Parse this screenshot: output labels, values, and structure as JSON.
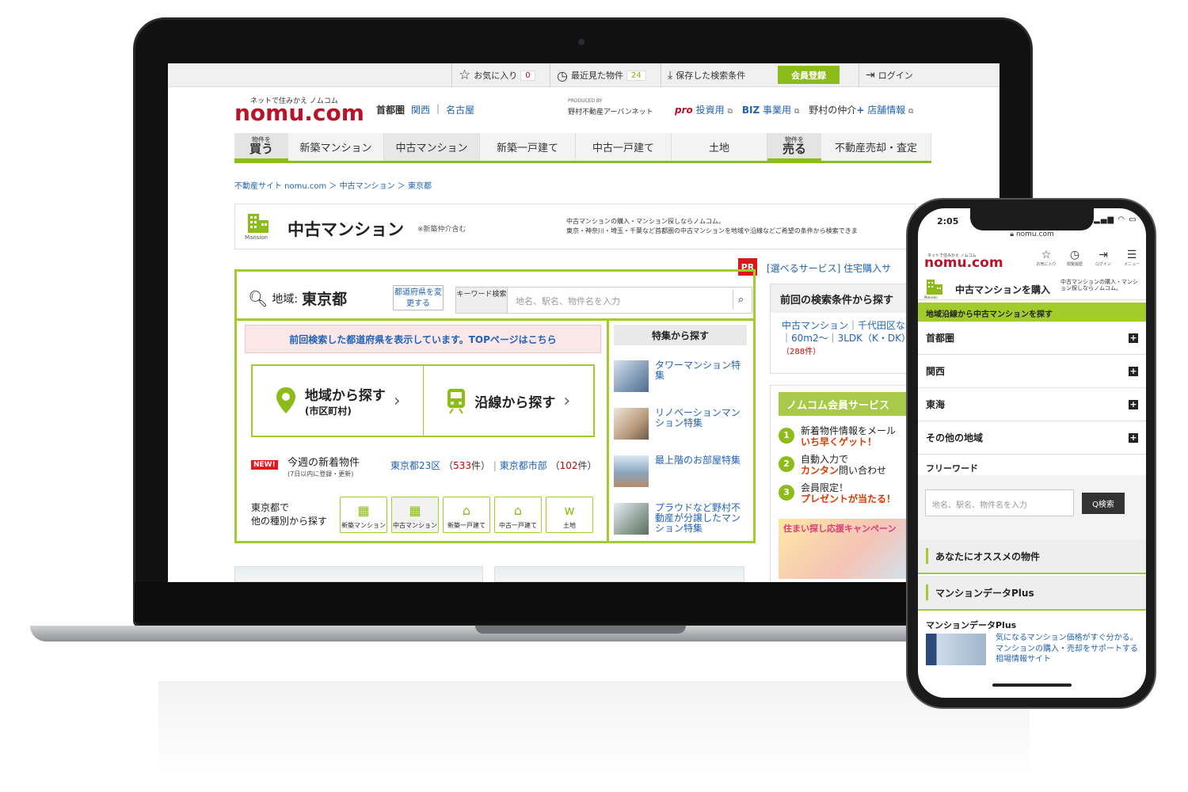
{
  "laptop": {
    "utility_bar": {
      "favorites_label": "お気に入り",
      "favorites_count": "0",
      "recent_label": "最近見た物件",
      "recent_count": "24",
      "saved_label": "保存した検索条件",
      "register_label": "会員登録",
      "login_label": "ログイン"
    },
    "header": {
      "tagline": "ネットで住みかえ ノムコム",
      "logo": "nomu.com",
      "region_current": "首都圏",
      "region_links": [
        "関西",
        "名古屋"
      ],
      "produced_by": "PRODUCED BY",
      "produced_name": "野村不動産アーバンネット",
      "pro_label": "pro",
      "invest_label": "投資用",
      "biz_label": "BIZ",
      "business_label": "事業用",
      "nomura_label": "野村の仲介",
      "plus_label": "+",
      "store_label": "店舗情報"
    },
    "nav": {
      "buy_small": "物件を",
      "buy_big": "買う",
      "items": [
        "新築マンション",
        "中古マンション",
        "新築一戸建て",
        "中古一戸建て",
        "土地"
      ],
      "sell_small": "物件を",
      "sell_big": "売る",
      "sell_item": "不動産売却・査定"
    },
    "breadcrumb": "不動産サイト nomu.com ＞ 中古マンション ＞ 東京都",
    "title": {
      "icon_label": "Mansion",
      "text": "中古マンション",
      "note": "※新築仲介含む",
      "desc_line1": "中古マンションの購入・マンション探しならノムコム。",
      "desc_line2": "東京・神奈川・埼玉・千葉など首都圏の中古マンションを地域や沿線などご希望の条件から検索できま"
    },
    "pr": {
      "badge": "PR",
      "text": "[選べるサービス] 住宅購入サ"
    },
    "search": {
      "region_prefix": "地域:",
      "region_value": "東京都",
      "change_label": "都道府県を変更する",
      "keyword_label": "キーワード検索",
      "keyword_placeholder": "地名、駅名、物件名を入力",
      "notice": "前回検索した都道府県を表示しています。TOPページはこちら",
      "area_label": "地域から探す",
      "area_sub": "(市区町村)",
      "line_label": "沿線から探す",
      "new_badge": "NEW!",
      "new_title": "今週の新着物件",
      "new_sub": "(7日以内に登録・更新)",
      "new_link1": "東京都23区",
      "new_count1": "533",
      "new_link2": "東京都市部",
      "new_count2": "102",
      "count_unit": "件",
      "other_label_1": "東京都で",
      "other_label_2": "他の種別から探す",
      "types": [
        "新築マンション",
        "中古マンション",
        "新築一戸建て",
        "中古一戸建て",
        "土地"
      ]
    },
    "features": {
      "heading": "特集から探す",
      "items": [
        "タワーマンション特集",
        "リノベーションマンション特集",
        "最上階のお部屋特集",
        "プラウドなど野村不動産が分譲したマンション特集"
      ]
    },
    "previous": {
      "heading": "前回の検索条件から探す",
      "text": "中古マンション｜千代田区など｜60m2〜｜3LDK（K・DK）",
      "count": "（288件）"
    },
    "member": {
      "heading": "ノムコム会員サービス",
      "items": [
        {
          "num": "1",
          "line1": "新着物件情報をメール",
          "em": "いち早くゲット！"
        },
        {
          "num": "2",
          "line1": "自動入力で",
          "em": "カンタン",
          "tail": "問い合わせ"
        },
        {
          "num": "3",
          "line1": "会員限定！",
          "em": "プレゼントが当たる！"
        }
      ],
      "campaign": "住まい探し応援キャンペーン"
    }
  },
  "phone": {
    "time": "2:05",
    "url": "nomu.com",
    "tagline": "ネットで住みかえ ノムコム",
    "logo": "nomu.com",
    "icons": [
      "お気に入り",
      "閲覧履歴",
      "ログイン",
      "メニュー"
    ],
    "section_icon_label": "Mansion",
    "section_title": "中古マンションを購入",
    "section_desc": "中古マンションの購入・マンション探しならノムコム。",
    "green_bar": "地域沿線から中古マンションを探す",
    "regions": [
      "首都圏",
      "関西",
      "東海",
      "その他の地域"
    ],
    "freeword_label": "フリーワード",
    "freeword_placeholder": "地名、駅名、物件名を入力",
    "search_button": "Q検索",
    "recommend": "あなたにオススメの物件",
    "data_plus": "マンションデータPlus",
    "data_plus_title": "マンションデータPlus",
    "data_plus_text": "気になるマンション価格がすぐ分かる。マンションの購入・売却をサポートする相場情報サイト"
  }
}
